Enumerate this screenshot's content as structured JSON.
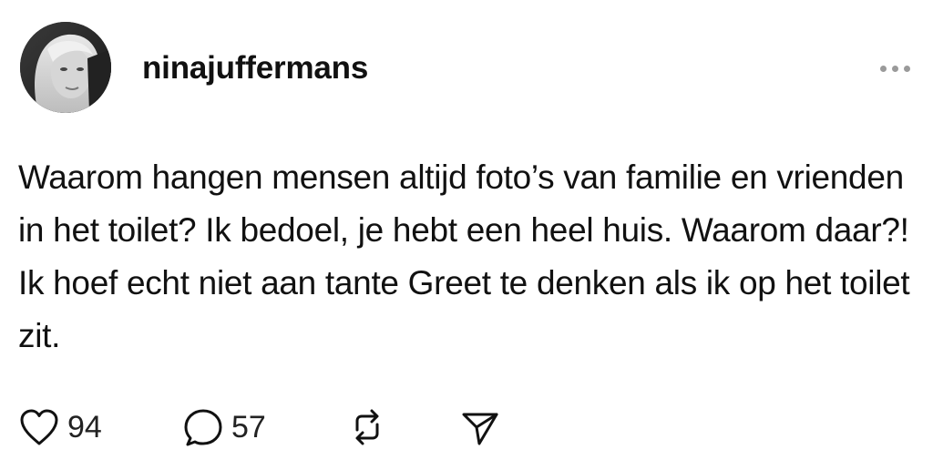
{
  "post": {
    "username": "ninajuffermans",
    "text": "Waarom hangen mensen altijd foto’s van familie en vrienden in het toilet? Ik bedoel, je hebt een heel huis. Waarom daar?! Ik hoef echt niet aan tante Greet te denken als ik op het toilet zit.",
    "likes": "94",
    "replies": "57"
  },
  "icons": {
    "avatar": "profile-photo",
    "more": "more-options-icon",
    "like": "heart-icon",
    "reply": "speech-bubble-icon",
    "repost": "repost-arrows-icon",
    "share": "paper-plane-icon"
  },
  "colors": {
    "text": "#111111",
    "muted": "#9a9a9a",
    "background": "#ffffff"
  }
}
